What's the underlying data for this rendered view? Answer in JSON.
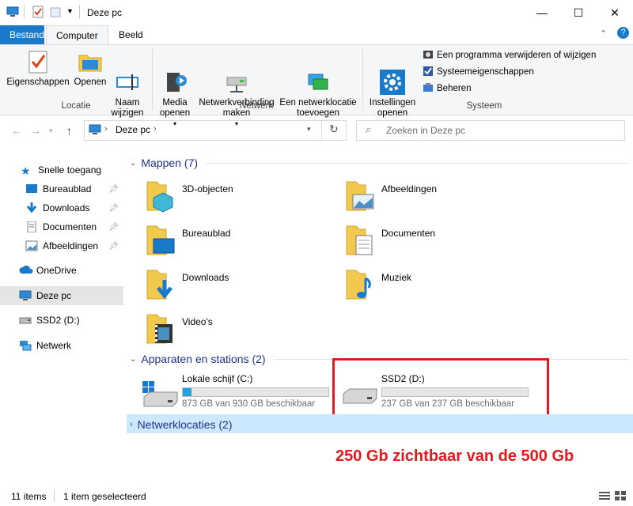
{
  "window": {
    "title": "Deze pc"
  },
  "tabs": [
    {
      "label": "Bestand"
    },
    {
      "label": "Computer"
    },
    {
      "label": "Beeld"
    }
  ],
  "ribbon": {
    "locatie": {
      "label": "Locatie",
      "items": [
        {
          "label": "Eigenschappen"
        },
        {
          "label": "Openen"
        },
        {
          "label": "Naam\nwijzigen"
        }
      ]
    },
    "netwerk": {
      "label": "Netwerk",
      "items": [
        {
          "label": "Media\nopenen"
        },
        {
          "label": "Netwerkverbinding\nmaken"
        },
        {
          "label": "Een netwerklocatie\ntoevoegen"
        }
      ]
    },
    "systeem": {
      "label": "Systeem",
      "items": [
        {
          "label": "Instellingen\nopenen"
        }
      ],
      "small": [
        {
          "label": "Een programma verwijderen of wijzigen"
        },
        {
          "label": "Systeemeigenschappen"
        },
        {
          "label": "Beheren"
        }
      ]
    }
  },
  "address": {
    "path": "Deze pc",
    "search_placeholder": "Zoeken in Deze pc"
  },
  "nav": {
    "items": [
      {
        "label": "Snelle toegang"
      },
      {
        "label": "Bureaublad"
      },
      {
        "label": "Downloads"
      },
      {
        "label": "Documenten"
      },
      {
        "label": "Afbeeldingen"
      },
      {
        "label": "OneDrive"
      },
      {
        "label": "Deze pc"
      },
      {
        "label": "SSD2 (D:)"
      },
      {
        "label": "Netwerk"
      }
    ]
  },
  "sections": {
    "mappen": "Mappen (7)",
    "apparaten": "Apparaten en stations (2)",
    "netwerk": "Netwerklocaties (2)"
  },
  "folders": [
    "3D-objecten",
    "Afbeeldingen",
    "Bureaublad",
    "Documenten",
    "Downloads",
    "Muziek",
    "Video's"
  ],
  "drives": [
    {
      "name": "Lokale schijf (C:)",
      "free_text": "873 GB van 930 GB beschikbaar",
      "used_fraction": 0.061
    },
    {
      "name": "SSD2 (D:)",
      "free_text": "237 GB van 237 GB beschikbaar",
      "used_fraction": 0.0
    }
  ],
  "annotation": {
    "text": "250 Gb zichtbaar van de 500 Gb",
    "color": "#e11b1b"
  },
  "status": {
    "count": "11 items",
    "selected": "1 item geselecteerd"
  },
  "colors": {
    "accent": "#1979ca",
    "folder": "#f2c94c",
    "bar": "#26a0da"
  }
}
